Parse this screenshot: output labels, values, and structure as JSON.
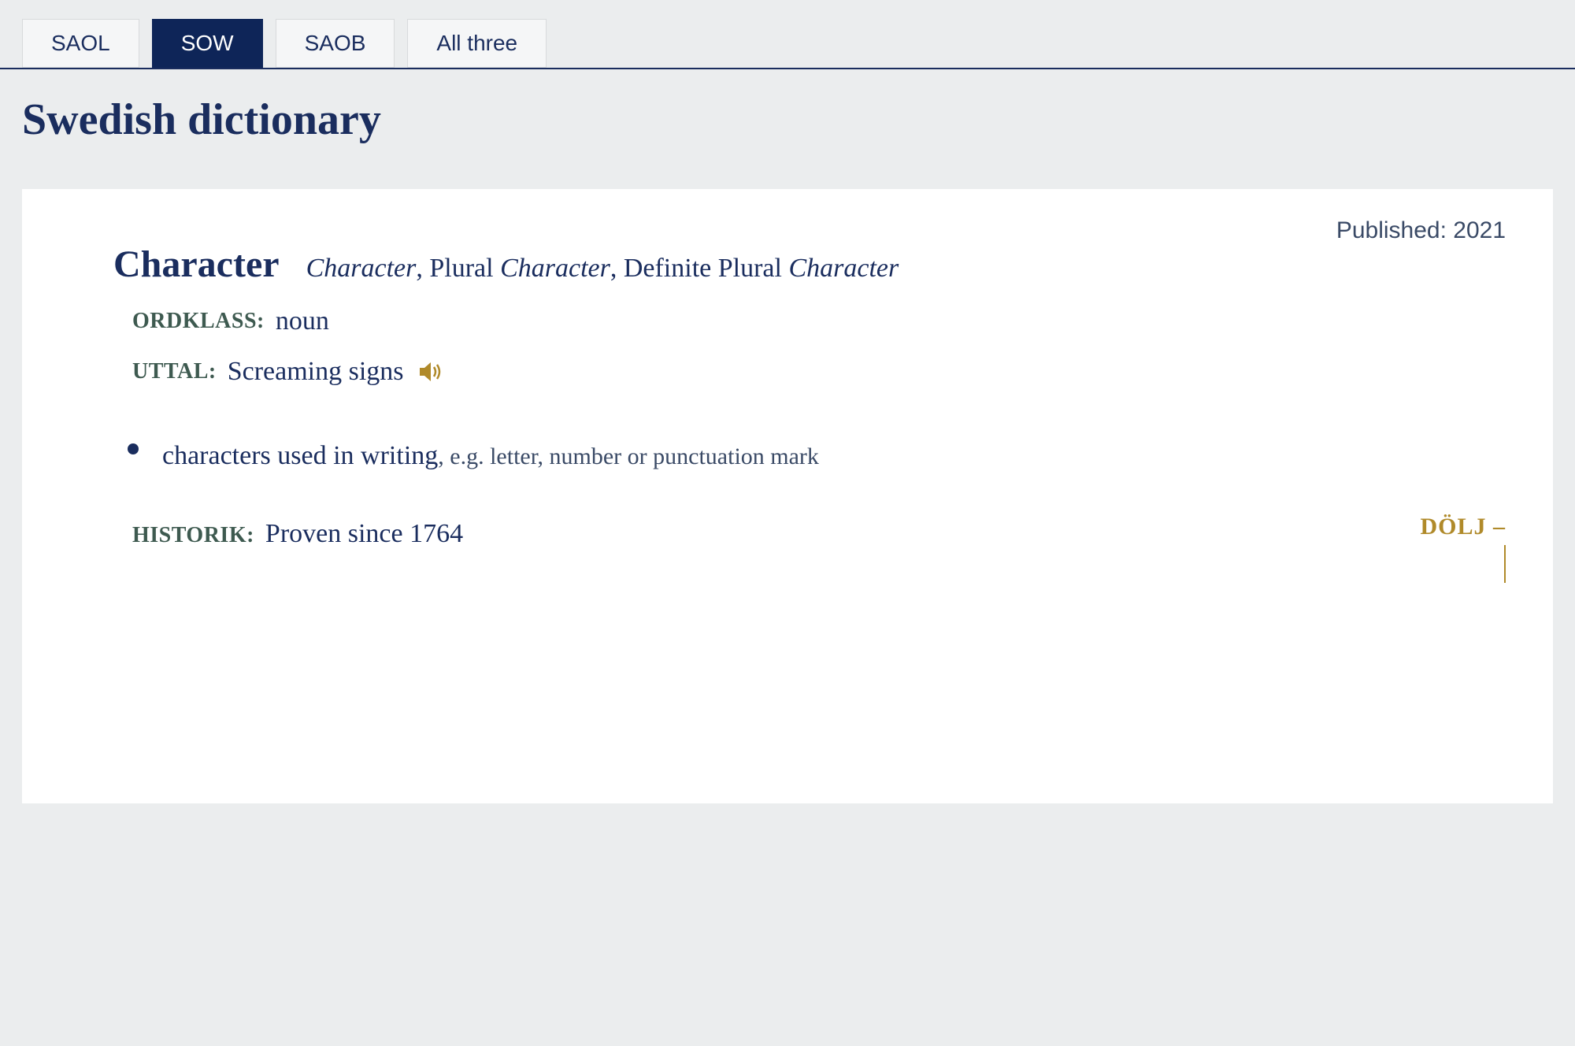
{
  "tabs": {
    "items": [
      {
        "label": "SAOL",
        "active": false
      },
      {
        "label": "SOW",
        "active": true
      },
      {
        "label": "SAOB",
        "active": false
      },
      {
        "label": "All three",
        "active": false
      }
    ]
  },
  "page_title": "Swedish dictionary",
  "published_label": "Published: 2021",
  "entry": {
    "headword": "Character",
    "inflections": {
      "base": "Character",
      "plural_label": "Plural",
      "plural": "Character",
      "def_plural_label": "Definite Plural",
      "def_plural": "Character"
    },
    "ordklass_label": "ORDKLASS:",
    "ordklass_value": "noun",
    "uttal_label": "UTTAL:",
    "uttal_value": "Screaming signs",
    "definition_main": "characters used in writing",
    "definition_expl": ", e.g. letter, number or punctuation mark",
    "historik_label": "HISTORIK:",
    "historik_value": "Proven since 1764"
  },
  "hide_toggle": "DÖLJ –"
}
